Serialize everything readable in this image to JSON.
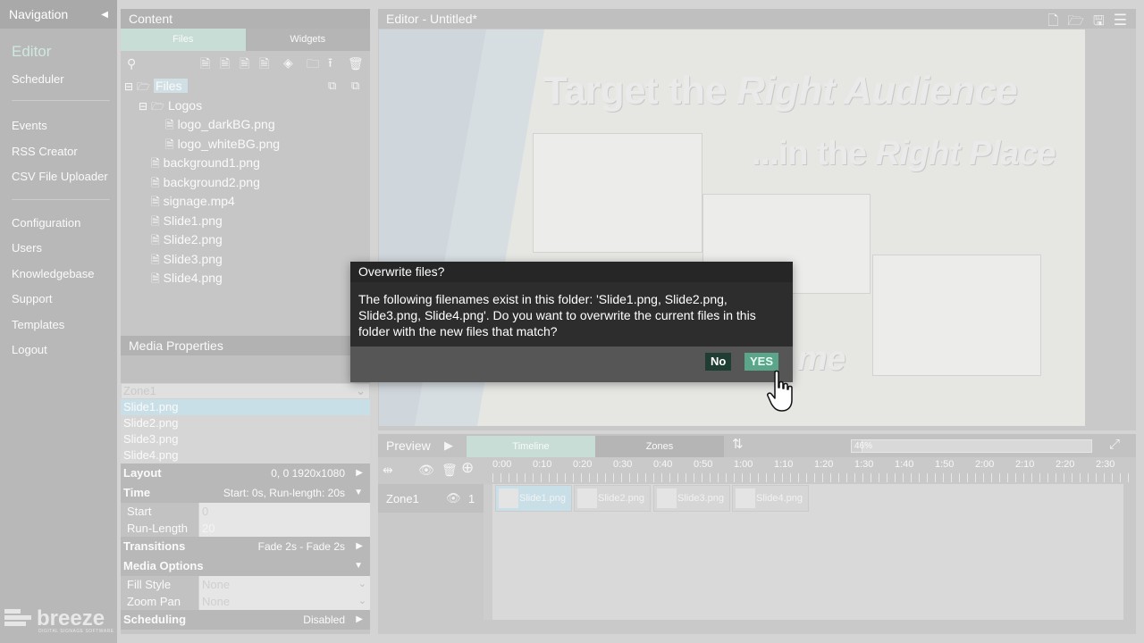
{
  "navigation": {
    "title": "Navigation",
    "items": [
      {
        "label": "Editor",
        "active": true
      },
      {
        "label": "Scheduler"
      },
      {
        "label": "Events"
      },
      {
        "label": "RSS Creator"
      },
      {
        "label": "CSV File Uploader"
      },
      {
        "label": "Configuration"
      },
      {
        "label": "Users"
      },
      {
        "label": "Knowledgebase"
      },
      {
        "label": "Support"
      },
      {
        "label": "Templates"
      },
      {
        "label": "Logout"
      }
    ],
    "logo_word": "breeze",
    "logo_tagline": "DIGITAL SIGNAGE SOFTWARE"
  },
  "content": {
    "title": "Content",
    "tabs": [
      "Files",
      "Widgets"
    ],
    "active_tab": "Files",
    "tree": {
      "root": "Files",
      "folder": "Logos",
      "folder_files": [
        "logo_darkBG.png",
        "logo_whiteBG.png"
      ],
      "files": [
        "background1.png",
        "background2.png",
        "signage.mp4",
        "Slide1.png",
        "Slide2.png",
        "Slide3.png",
        "Slide4.png"
      ]
    }
  },
  "media_properties": {
    "title": "Media Properties",
    "zone": "Zone1",
    "list": [
      "Slide1.png",
      "Slide2.png",
      "Slide3.png",
      "Slide4.png"
    ],
    "layout": {
      "label": "Layout",
      "value": "0, 0   1920x1080"
    },
    "time": {
      "label": "Time",
      "value": "Start: 0s, Run-length: 20s"
    },
    "start": {
      "label": "Start",
      "value": "0"
    },
    "run_length": {
      "label": "Run-Length",
      "value": "20"
    },
    "transitions": {
      "label": "Transitions",
      "value": "Fade 2s - Fade 2s"
    },
    "media_options": {
      "label": "Media Options"
    },
    "fill_style": {
      "label": "Fill Style",
      "value": "None"
    },
    "zoom_pan": {
      "label": "Zoom Pan",
      "value": "None"
    },
    "scheduling": {
      "label": "Scheduling",
      "value": "Disabled"
    }
  },
  "editor": {
    "title": "Editor - Untitled*",
    "canvas": {
      "line1_a": "Target the ",
      "line1_b": "Right Audience",
      "line2_a": "...in the ",
      "line2_b": "Right Place",
      "partial": "me"
    }
  },
  "preview": {
    "title": "Preview",
    "tabs": [
      "Timeline",
      "Zones"
    ],
    "active_tab": "Timeline",
    "zoom_percent": 46,
    "zoom_label": "46%",
    "ruler": [
      "0:00",
      "0:10",
      "0:20",
      "0:30",
      "0:40",
      "0:50",
      "1:00",
      "1:10",
      "1:20",
      "1:30",
      "1:40",
      "1:50",
      "2:00",
      "2:10",
      "2:20",
      "2:30"
    ],
    "zone": {
      "name": "Zone1",
      "count": "1"
    },
    "clips": [
      "Slide1.png",
      "Slide2.png",
      "Slide3.png",
      "Slide4.png"
    ]
  },
  "dialog": {
    "title": "Overwrite files?",
    "message": "The following filenames exist in this folder: 'Slide1.png, Slide2.png, Slide3.png, Slide4.png'. Do you want to overwrite the current files in this folder with the new files that match?",
    "no_label": "No",
    "yes_label": "YES"
  }
}
